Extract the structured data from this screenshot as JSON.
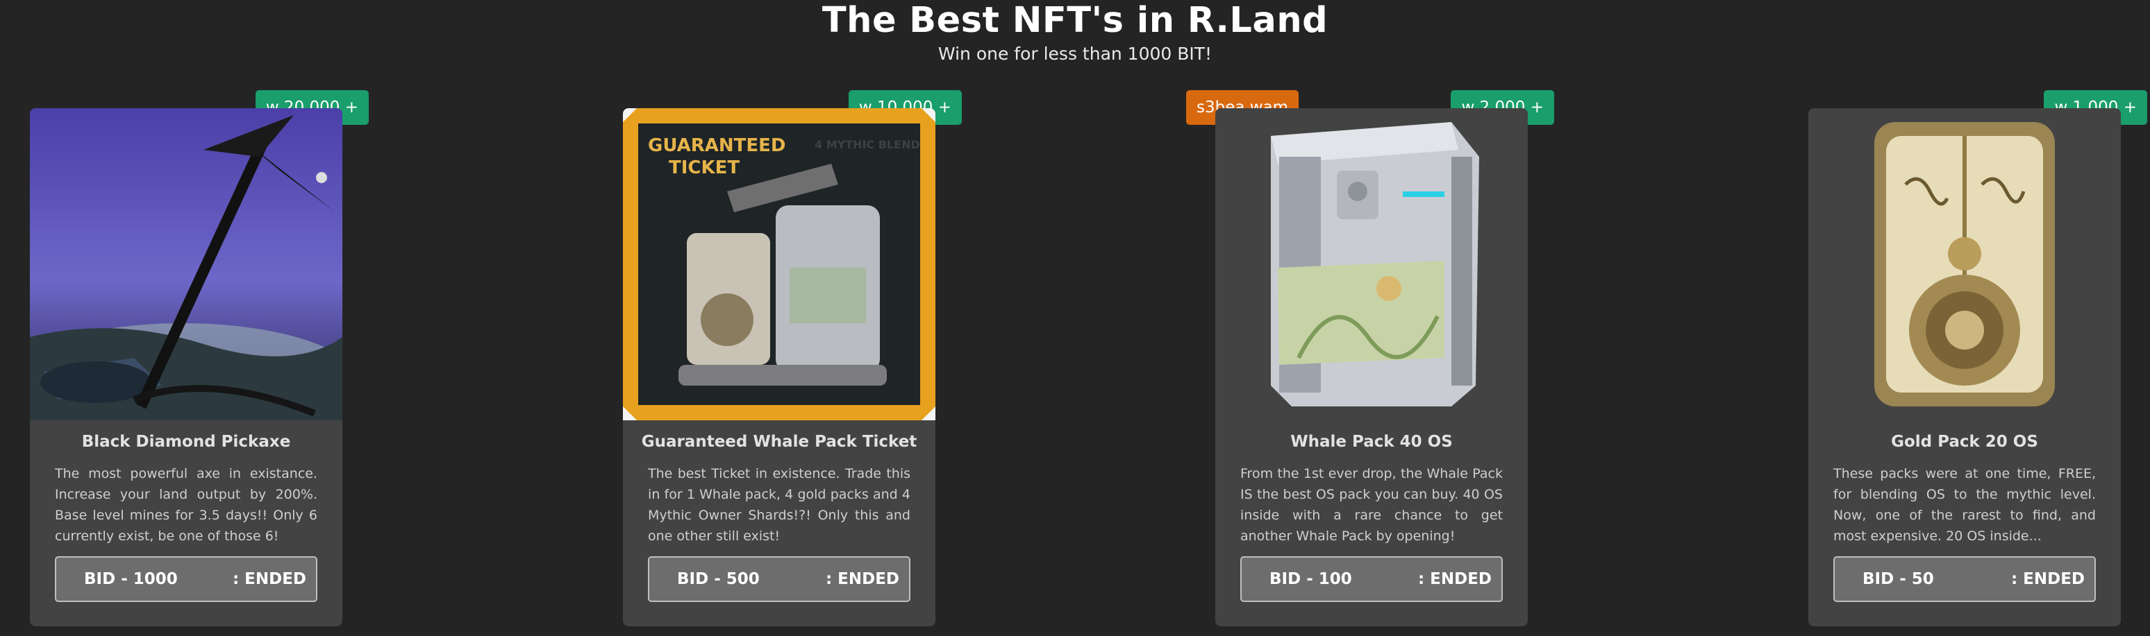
{
  "header": {
    "title": "The Best NFT's in R.Land",
    "subtitle": "Win one for less than 1000 BIT!"
  },
  "cards": [
    {
      "name": "Black Diamond Pickaxe",
      "description": "The most powerful axe in existance. Increase your land output by 200%. Base level mines for 3.5 days!! Only 6 currently exist, be one of those 6!",
      "price_badge": "w 20,000 +",
      "bid_label": "BID - 1000",
      "status": ": ENDED"
    },
    {
      "name": "Guaranteed Whale Pack Ticket",
      "description": "The best Ticket in existence. Trade this in for 1 Whale pack, 4 gold packs and 4 Mythic Owner Shards!?! Only this and one other still exist!",
      "price_badge": "w 10,000 +",
      "bid_label": "BID - 500",
      "status": ": ENDED",
      "image_text": {
        "line1": "GUARANTEED",
        "line2": "TICKET",
        "corner": "4 MYTHIC BLEND"
      }
    },
    {
      "name": "Whale Pack 40 OS",
      "description": "From the 1st ever drop, the Whale Pack IS the best OS pack you can buy. 40 OS inside with a rare chance to get another Whale Pack by opening!",
      "price_badge": "w 2,000 +",
      "owner_badge": "s3bea.wam",
      "bid_label": "BID - 100",
      "status": ": ENDED"
    },
    {
      "name": "Gold Pack 20 OS",
      "description": "These packs were at one time, FREE, for blending OS to the mythic level. Now, one of the rarest to find, and most expensive. 20 OS inside...",
      "price_badge": "w 1,000 +",
      "bid_label": "BID - 50",
      "status": ": ENDED"
    }
  ]
}
